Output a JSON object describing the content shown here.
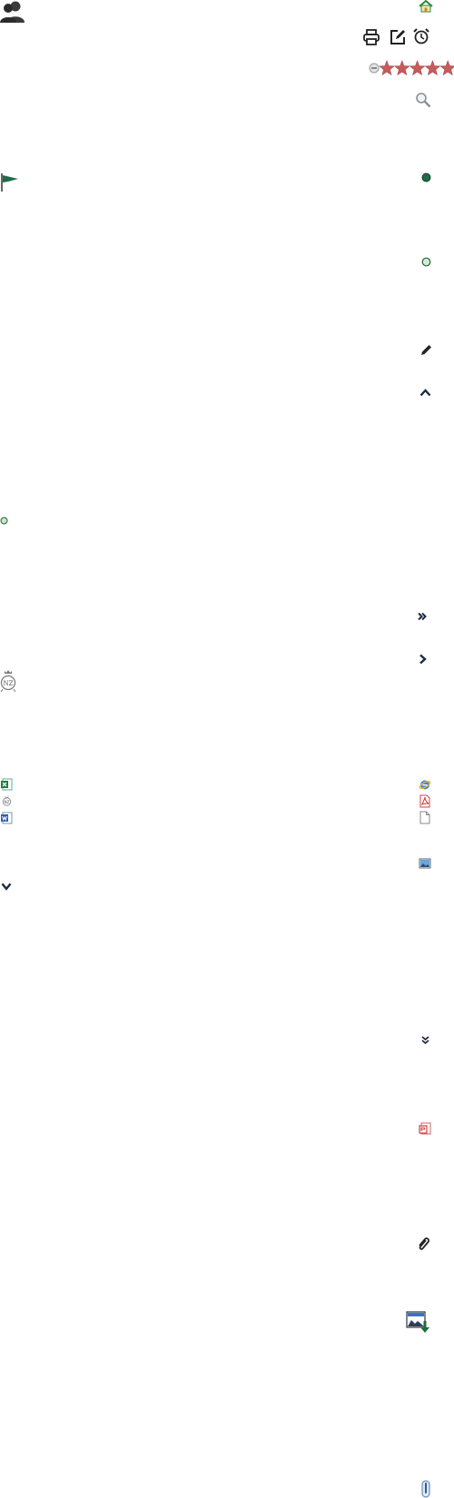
{
  "toolbar": {
    "users_icon": "users-icon",
    "home_icon": "home-icon",
    "print_icon": "print-icon",
    "edit_icon": "edit-icon",
    "alarm_icon": "alarm-clock-icon"
  },
  "rating": {
    "clear_icon": "clear-rating-icon",
    "star_icon": "star-icon",
    "stars_total": 5,
    "stars_selected": 0,
    "star_color": "#c85a5a"
  },
  "icons": [
    "search-icon",
    "flag-icon",
    "green-dot-filled-icon",
    "green-dot-outline-icon",
    "pencil-icon",
    "chevron-up-icon",
    "small-circle-icon",
    "double-chevron-right-icon",
    "chevron-right-icon",
    "nz-crest-icon",
    "excel-file-icon",
    "internet-explorer-icon",
    "nz-crest-small-icon",
    "pdf-file-icon",
    "word-file-icon",
    "blank-file-icon",
    "image-file-icon",
    "chevron-down-icon",
    "double-chevron-down-icon",
    "powerpoint-file-icon",
    "paperclip-icon",
    "image-download-icon",
    "scroll-handle-icon"
  ],
  "colors": {
    "brand_green": "#1f6b4a",
    "navy": "#1e2a44",
    "star": "#c85a5a"
  }
}
